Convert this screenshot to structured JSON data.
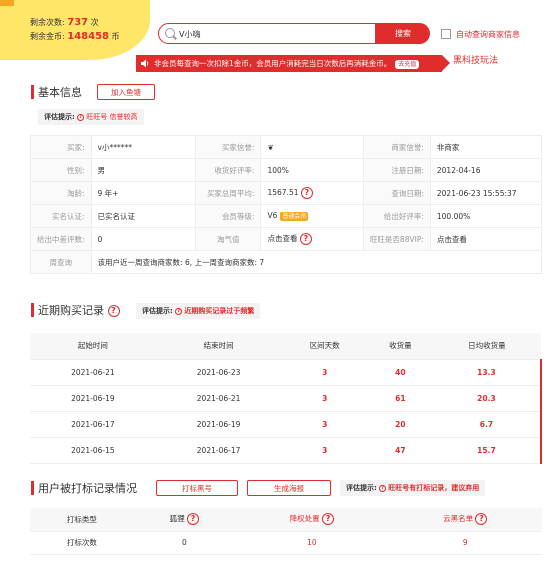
{
  "counters": {
    "remaining_label": "剩余次数:",
    "remaining_value": "737",
    "remaining_unit": "次",
    "coins_label": "剩余金币:",
    "coins_value": "148458",
    "coins_unit": "币"
  },
  "search": {
    "value": "V小嗨",
    "button": "搜索",
    "auto_label": "自动查询商家信息"
  },
  "notice": {
    "text": "非会员每查询一次扣除1金币，会员用户消耗完当日次数后再消耗金币。",
    "recharge": "去充值",
    "tech_link": "黑科技玩法"
  },
  "basic": {
    "title": "基本信息",
    "add_btn": "加入鱼塘",
    "hint_label": "评估提示:",
    "hint_value": "旺旺号 信誉较高",
    "rows": [
      [
        [
          "买家:",
          "v小******"
        ],
        [
          "买家信誉:",
          "❦"
        ],
        [
          "商家信誉:",
          "非商家"
        ]
      ],
      [
        [
          "性别:",
          "男"
        ],
        [
          "收货好评率:",
          "100%"
        ],
        [
          "注册日期:",
          "2012-04-16"
        ]
      ],
      [
        [
          "淘龄:",
          "9 年+"
        ],
        [
          "买家总周平均:",
          "1567.51"
        ],
        [
          "查询日期:",
          "2021-06-23 15:55:37"
        ]
      ],
      [
        [
          "实名认证:",
          "已实名认证"
        ],
        [
          "会员等级:",
          "V6"
        ],
        [
          "给出好评率:",
          "100.00%"
        ]
      ],
      [
        [
          "给出中差评数:",
          "0"
        ],
        [
          "淘气值",
          "点击查看"
        ],
        [
          "旺旺是否88VIP:",
          "点击查看"
        ]
      ]
    ],
    "vip_badge": "普通会员",
    "week_label": "周查询",
    "week_value": "该用户近一周查询商家数: 6, 上一周查询商家数: 7"
  },
  "recent": {
    "title": "近期购买记录",
    "hint_label": "评估提示:",
    "hint_value": "近期购买记录过于频繁",
    "headers": [
      "起始时间",
      "结束时间",
      "区间天数",
      "收货量",
      "日均收货量"
    ],
    "rows": [
      [
        "2021-06-21",
        "2021-06-23",
        "3",
        "40",
        "13.3"
      ],
      [
        "2021-06-19",
        "2021-06-21",
        "3",
        "61",
        "20.3"
      ],
      [
        "2021-06-17",
        "2021-06-19",
        "3",
        "20",
        "6.7"
      ],
      [
        "2021-06-15",
        "2021-06-17",
        "3",
        "47",
        "15.7"
      ]
    ]
  },
  "tagging": {
    "title": "用户被打标记录情况",
    "btn1": "打标黑号",
    "btn2": "生成海报",
    "hint_label": "评估提示:",
    "hint_value": "旺旺号有打标记录，建议弃用",
    "headers": [
      "打标类型",
      "狐狸",
      "降权处置",
      "云黑名单"
    ],
    "row_label": "打标次数",
    "values": [
      "0",
      "10",
      "9"
    ]
  },
  "icons": {
    "search": "search-icon",
    "speaker": "speaker-icon",
    "help": "question-circle-icon",
    "accent": "#e02c2c"
  }
}
